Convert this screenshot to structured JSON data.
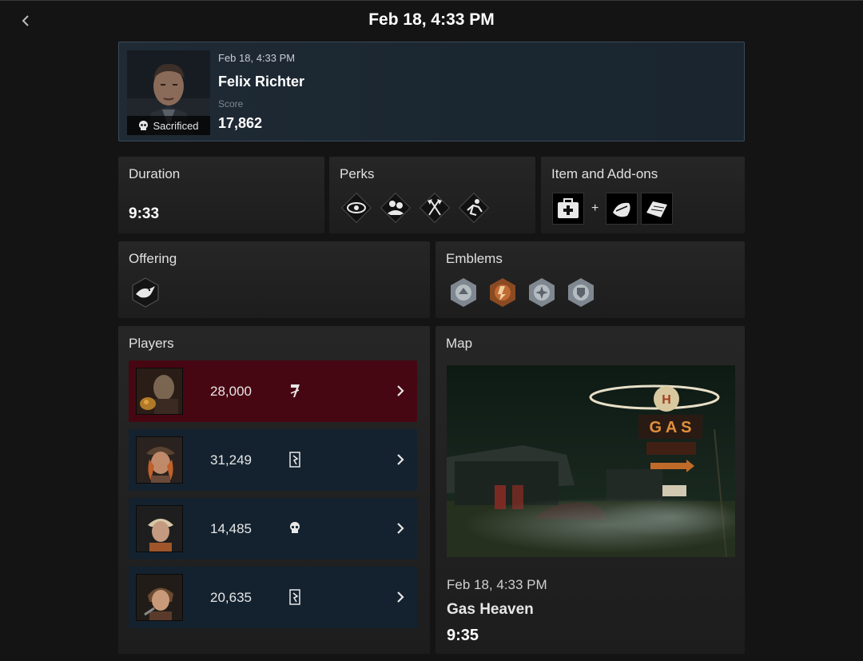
{
  "header": {
    "title": "Feb 18, 4:33 PM",
    "back_icon": "chevron-left-icon"
  },
  "match": {
    "date": "Feb 18, 4:33 PM",
    "character": "Felix Richter",
    "status": "Sacrificed",
    "score_label": "Score",
    "score": "17,862"
  },
  "duration": {
    "title": "Duration",
    "value": "9:33"
  },
  "perks": {
    "title": "Perks",
    "icons": [
      "eye-perk-icon",
      "hands-perk-icon",
      "axes-perk-icon",
      "sprint-perk-icon"
    ]
  },
  "item": {
    "title": "Item and Add-ons",
    "item_icon": "medkit-icon",
    "plus": "+",
    "addons": [
      "bandage-addon-icon",
      "gauze-addon-icon"
    ]
  },
  "offering": {
    "title": "Offering",
    "icon": "crow-offering-icon"
  },
  "emblems": {
    "title": "Emblems",
    "icons": [
      "silver-emblem-icon",
      "bronze-emblem-icon",
      "silver-emblem-icon",
      "silver-emblem-icon"
    ]
  },
  "players": {
    "title": "Players",
    "rows": [
      {
        "role": "killer",
        "score": "28,000",
        "status_icon": "killer-mark-icon"
      },
      {
        "role": "survivor",
        "score": "31,249",
        "status_icon": "escaped-icon"
      },
      {
        "role": "survivor",
        "score": "14,485",
        "status_icon": "sacrificed-skull-icon"
      },
      {
        "role": "survivor",
        "score": "20,635",
        "status_icon": "escaped-icon"
      }
    ]
  },
  "map": {
    "title": "Map",
    "date": "Feb 18, 4:33 PM",
    "name": "Gas Heaven",
    "duration": "9:35"
  },
  "colors": {
    "killer_row": "#470712",
    "survivor_row": "#14222f",
    "hero_border": "#3a4a58",
    "background": "#141414"
  }
}
